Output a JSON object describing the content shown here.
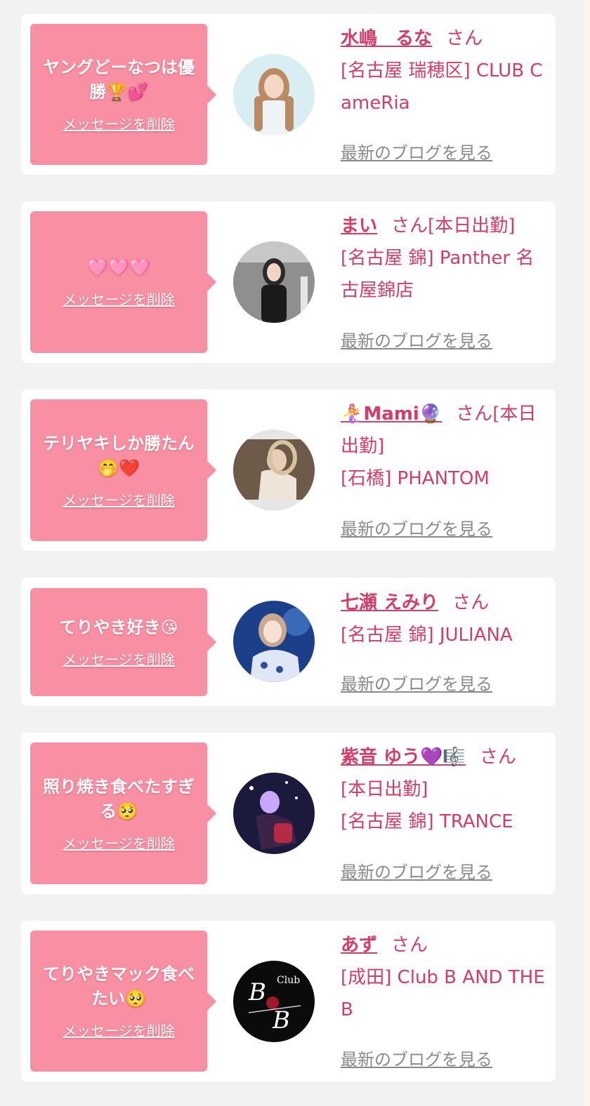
{
  "colors": {
    "background": "#f2f2f2",
    "card": "#ffffff",
    "bubble": "#f98fa2",
    "accent_text": "#d23d6a",
    "link_gray": "#8a8a8a"
  },
  "delete_label": "メッセージを削除",
  "blog_label": "最新のブログを見る",
  "san_label": "さん",
  "cards": [
    {
      "message": "ヤングどーなつは優勝🏆💕",
      "name": "水嶋　るな",
      "status": "",
      "shop": "[名古屋 瑞穂区] CLUB CameRia"
    },
    {
      "message": "🩷🩷🩷",
      "name": "まい",
      "status": "[本日出勤]",
      "shop": "[名古屋 錦] Panther 名古屋錦店"
    },
    {
      "message": "テリヤキしか勝たん🤭❤️",
      "name": "🧜‍♀️Mami🔮",
      "status": "[本日出勤]",
      "shop": "[石橋] PHANTOM"
    },
    {
      "message": "てりやき好き😘",
      "name": "七瀬 えみり",
      "status": "",
      "shop": "[名古屋 錦] JULIANA"
    },
    {
      "message": "照り焼き食べたすぎる🥺",
      "name": "紫音 ゆう💜🎼",
      "status": "[本日出勤]",
      "shop": "[名古屋 錦] TRANCE"
    },
    {
      "message": "てりやきマック食べたい🥺",
      "name": "あず",
      "status": "",
      "shop": "[成田] Club B AND THE B"
    }
  ]
}
